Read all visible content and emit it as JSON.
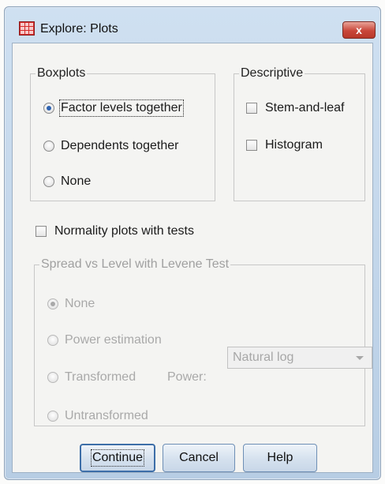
{
  "window": {
    "title": "Explore: Plots",
    "close_glyph": "x"
  },
  "boxplots": {
    "legend": "Boxplots",
    "options": [
      {
        "label": "Factor levels together",
        "selected": true
      },
      {
        "label": "Dependents together",
        "selected": false
      },
      {
        "label": "None",
        "selected": false
      }
    ]
  },
  "descriptive": {
    "legend": "Descriptive",
    "options": [
      {
        "label": "Stem-and-leaf",
        "checked": false
      },
      {
        "label": "Histogram",
        "checked": false
      }
    ]
  },
  "normality": {
    "label": "Normality plots with tests",
    "checked": false
  },
  "spread": {
    "legend": "Spread vs Level with Levene Test",
    "options": [
      {
        "label": "None",
        "selected": true
      },
      {
        "label": "Power estimation",
        "selected": false
      },
      {
        "label": "Transformed",
        "selected": false
      },
      {
        "label": "Untransformed",
        "selected": false
      }
    ],
    "power_label": "Power:",
    "power_value": "Natural log",
    "enabled": false
  },
  "buttons": {
    "continue": "Continue",
    "cancel": "Cancel",
    "help": "Help"
  },
  "colors": {
    "titlebar": "#c6d9ee",
    "close_button": "#c9473a",
    "selected_radio": "#2f63b0",
    "disabled_text": "#a9a9a9"
  }
}
